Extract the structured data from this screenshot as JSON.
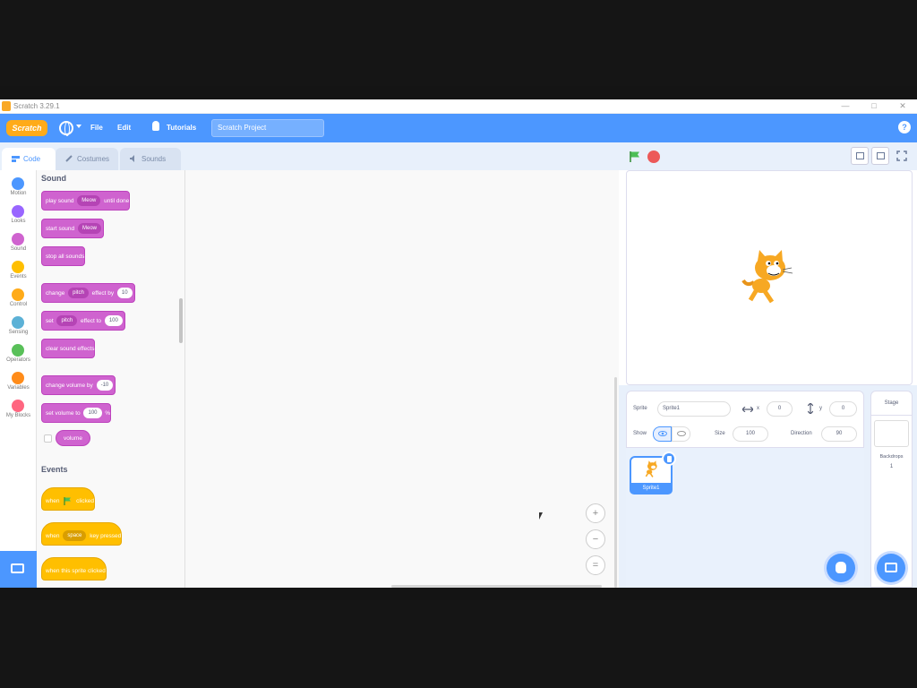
{
  "window": {
    "title": "Scratch 3.29.1",
    "controls": [
      "—",
      "□",
      "✕"
    ]
  },
  "menubar": {
    "logo": "Scratch",
    "file": "File",
    "edit": "Edit",
    "tutorials": "Tutorials",
    "project_title": "Scratch Project",
    "help": "?"
  },
  "tabs": [
    {
      "label": "Code"
    },
    {
      "label": "Costumes"
    },
    {
      "label": "Sounds"
    }
  ],
  "categories": [
    {
      "label": "Motion",
      "color": "#4c97ff"
    },
    {
      "label": "Looks",
      "color": "#9966ff"
    },
    {
      "label": "Sound",
      "color": "#cf63cf"
    },
    {
      "label": "Events",
      "color": "#ffbf00"
    },
    {
      "label": "Control",
      "color": "#ffab19"
    },
    {
      "label": "Sensing",
      "color": "#5cb1d6"
    },
    {
      "label": "Operators",
      "color": "#59c059"
    },
    {
      "label": "Variables",
      "color": "#ff8c1a"
    },
    {
      "label": "My Blocks",
      "color": "#ff6680"
    }
  ],
  "palette": {
    "sound_heading": "Sound",
    "events_heading": "Events",
    "play_sound": {
      "a": "play sound",
      "menu": "Meow",
      "b": "until done"
    },
    "start_sound": {
      "a": "start sound",
      "menu": "Meow"
    },
    "stop_all": "stop all sounds",
    "change_effect": {
      "a": "change",
      "menu": "pitch",
      "b": "effect by",
      "val": "10"
    },
    "set_effect": {
      "a": "set",
      "menu": "pitch",
      "b": "effect to",
      "val": "100"
    },
    "clear_effects": "clear sound effects",
    "change_volume": {
      "a": "change volume by",
      "val": "-10"
    },
    "set_volume": {
      "a": "set volume to",
      "val": "100",
      "b": "%"
    },
    "volume": "volume",
    "when_flag": {
      "a": "when",
      "b": "clicked"
    },
    "when_key": {
      "a": "when",
      "menu": "space",
      "b": "key pressed"
    },
    "when_sprite": "when this sprite clicked"
  },
  "zoom": {
    "in": "+",
    "out": "−",
    "reset": "="
  },
  "sprite_info": {
    "sprite_label": "Sprite",
    "sprite_name": "Sprite1",
    "x_label": "x",
    "x_value": "0",
    "y_label": "y",
    "y_value": "0",
    "show_label": "Show",
    "size_label": "Size",
    "size_value": "100",
    "direction_label": "Direction",
    "direction_value": "90"
  },
  "sprite_list": [
    {
      "name": "Sprite1"
    }
  ],
  "stage_pane": {
    "title": "Stage",
    "backdrops_label": "Backdrops",
    "backdrops_count": "1"
  }
}
